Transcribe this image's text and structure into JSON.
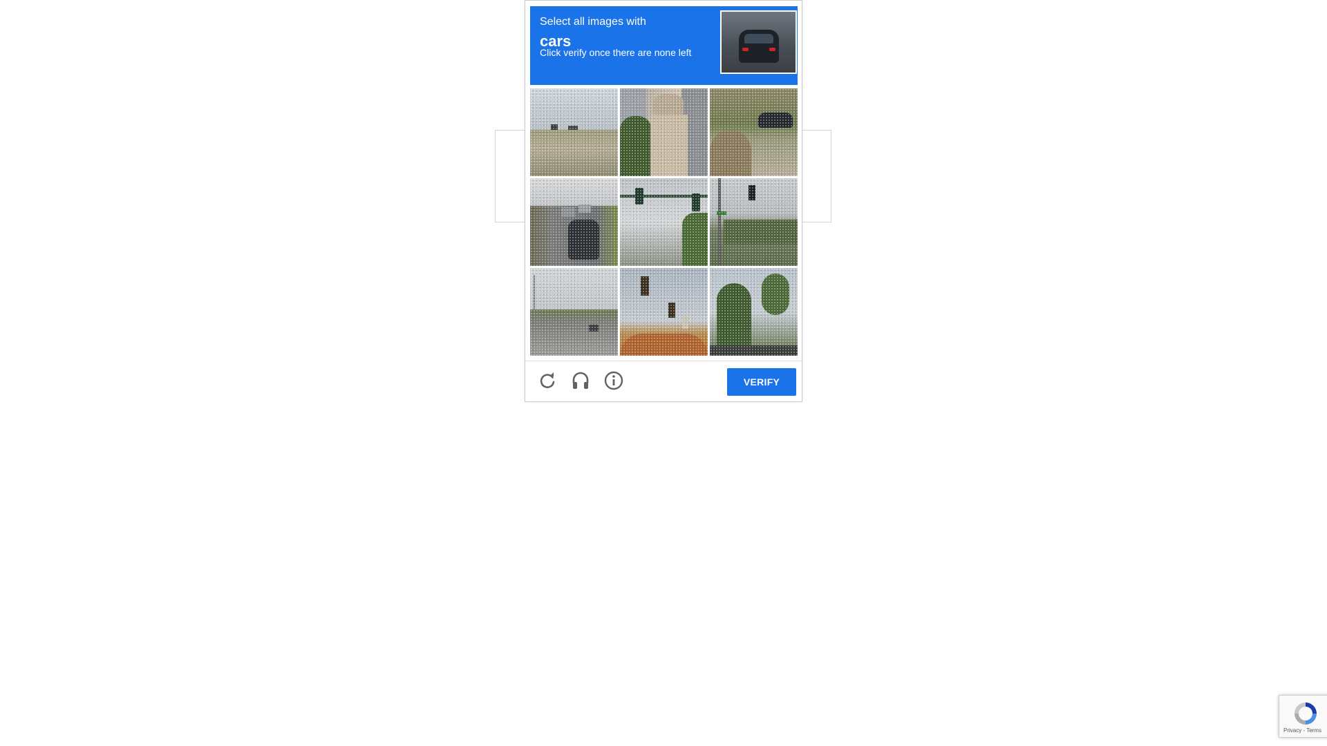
{
  "challenge": {
    "instruction_line1": "Select all images with",
    "target_object": "cars",
    "instruction_line3": "Click verify once there are none left",
    "sample_image_icon": "car-rear-photo",
    "header_color": "#1a73e8",
    "tiles": [
      {
        "index": 1,
        "description_icon": "field-with-distant-vehicles-photo"
      },
      {
        "index": 2,
        "description_icon": "stone-urn-pillar-photo"
      },
      {
        "index": 3,
        "description_icon": "garden-with-parked-car-photo"
      },
      {
        "index": 4,
        "description_icon": "highway-traffic-cars-photo"
      },
      {
        "index": 5,
        "description_icon": "traffic-lights-over-road-photo"
      },
      {
        "index": 6,
        "description_icon": "traffic-light-and-bridge-photo"
      },
      {
        "index": 7,
        "description_icon": "road-with-car-photo"
      },
      {
        "index": 8,
        "description_icon": "hanging-traffic-lights-photo"
      },
      {
        "index": 9,
        "description_icon": "trees-and-palms-photo"
      }
    ]
  },
  "footer": {
    "reload_icon": "reload-icon",
    "audio_icon": "headphones-icon",
    "info_icon": "info-icon",
    "verify_label": "VERIFY"
  },
  "badge": {
    "text": "Privacy - Terms"
  }
}
